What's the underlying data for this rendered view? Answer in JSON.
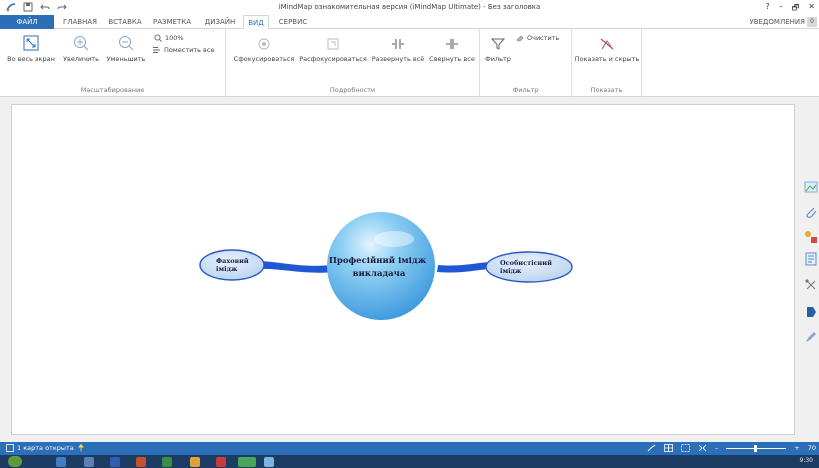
{
  "window": {
    "title": "iMindMap ознакомительная версия (iMindMap Ultimate) - Без заголовка",
    "help": "?",
    "minimize": "–",
    "restore": "🗗",
    "close": "✕"
  },
  "tabs": {
    "file": "ФАЙЛ",
    "items": [
      "ГЛАВНАЯ",
      "ВСТАВКА",
      "РАЗМЕТКА",
      "ДИЗАЙН",
      "ВИД",
      "СЕРВИС"
    ],
    "active": "ВИД",
    "notifications": "УВЕДОМЛЕНИЯ",
    "notifications_count": "0"
  },
  "ribbon": {
    "scale": {
      "label": "Масштабирование",
      "fit_screen": "Во весь экран",
      "zoom_in": "Увеличить",
      "zoom_out": "Уменьшить",
      "zoom_100": "100%",
      "fit_all": "Поместить все"
    },
    "details": {
      "label": "Подробности",
      "focus": "Сфокусироваться",
      "unfocus": "Расфокусироваться",
      "expand_all": "Развернуть всё",
      "collapse_all": "Свернуть все"
    },
    "filter": {
      "label": "Фильтр",
      "filter": "Фильтр",
      "clear": "Очистить"
    },
    "show": {
      "label": "Показать",
      "show_hide": "Показать и скрыть"
    }
  },
  "map": {
    "central": [
      "Професійний імідж",
      "викладача"
    ],
    "left_branch": [
      "Фаховий",
      "імідж"
    ],
    "right_branch": [
      "Особистісний",
      "імідж"
    ]
  },
  "status": {
    "maps_open": "1 карта открыта",
    "zoom_minus": "–",
    "zoom_plus": "+",
    "zoom_value": "70"
  },
  "taskbar": {
    "clock": "9:30"
  },
  "colors": {
    "accent": "#2a6fb8",
    "taskbar": "#1d3c63",
    "branch": "#1f57d6",
    "central_fill": "#5fb4ee"
  }
}
